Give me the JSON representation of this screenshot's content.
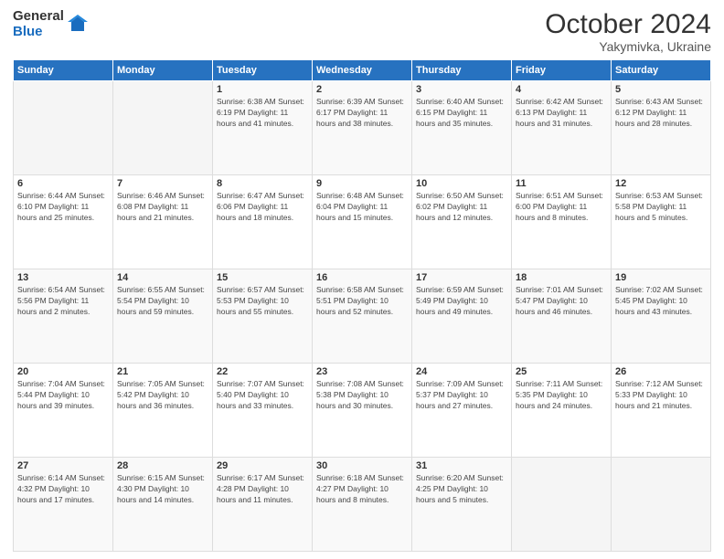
{
  "logo": {
    "general": "General",
    "blue": "Blue"
  },
  "title": {
    "month": "October 2024",
    "location": "Yakymivka, Ukraine"
  },
  "headers": [
    "Sunday",
    "Monday",
    "Tuesday",
    "Wednesday",
    "Thursday",
    "Friday",
    "Saturday"
  ],
  "weeks": [
    [
      {
        "day": "",
        "detail": ""
      },
      {
        "day": "",
        "detail": ""
      },
      {
        "day": "1",
        "detail": "Sunrise: 6:38 AM\nSunset: 6:19 PM\nDaylight: 11 hours and 41 minutes."
      },
      {
        "day": "2",
        "detail": "Sunrise: 6:39 AM\nSunset: 6:17 PM\nDaylight: 11 hours and 38 minutes."
      },
      {
        "day": "3",
        "detail": "Sunrise: 6:40 AM\nSunset: 6:15 PM\nDaylight: 11 hours and 35 minutes."
      },
      {
        "day": "4",
        "detail": "Sunrise: 6:42 AM\nSunset: 6:13 PM\nDaylight: 11 hours and 31 minutes."
      },
      {
        "day": "5",
        "detail": "Sunrise: 6:43 AM\nSunset: 6:12 PM\nDaylight: 11 hours and 28 minutes."
      }
    ],
    [
      {
        "day": "6",
        "detail": "Sunrise: 6:44 AM\nSunset: 6:10 PM\nDaylight: 11 hours and 25 minutes."
      },
      {
        "day": "7",
        "detail": "Sunrise: 6:46 AM\nSunset: 6:08 PM\nDaylight: 11 hours and 21 minutes."
      },
      {
        "day": "8",
        "detail": "Sunrise: 6:47 AM\nSunset: 6:06 PM\nDaylight: 11 hours and 18 minutes."
      },
      {
        "day": "9",
        "detail": "Sunrise: 6:48 AM\nSunset: 6:04 PM\nDaylight: 11 hours and 15 minutes."
      },
      {
        "day": "10",
        "detail": "Sunrise: 6:50 AM\nSunset: 6:02 PM\nDaylight: 11 hours and 12 minutes."
      },
      {
        "day": "11",
        "detail": "Sunrise: 6:51 AM\nSunset: 6:00 PM\nDaylight: 11 hours and 8 minutes."
      },
      {
        "day": "12",
        "detail": "Sunrise: 6:53 AM\nSunset: 5:58 PM\nDaylight: 11 hours and 5 minutes."
      }
    ],
    [
      {
        "day": "13",
        "detail": "Sunrise: 6:54 AM\nSunset: 5:56 PM\nDaylight: 11 hours and 2 minutes."
      },
      {
        "day": "14",
        "detail": "Sunrise: 6:55 AM\nSunset: 5:54 PM\nDaylight: 10 hours and 59 minutes."
      },
      {
        "day": "15",
        "detail": "Sunrise: 6:57 AM\nSunset: 5:53 PM\nDaylight: 10 hours and 55 minutes."
      },
      {
        "day": "16",
        "detail": "Sunrise: 6:58 AM\nSunset: 5:51 PM\nDaylight: 10 hours and 52 minutes."
      },
      {
        "day": "17",
        "detail": "Sunrise: 6:59 AM\nSunset: 5:49 PM\nDaylight: 10 hours and 49 minutes."
      },
      {
        "day": "18",
        "detail": "Sunrise: 7:01 AM\nSunset: 5:47 PM\nDaylight: 10 hours and 46 minutes."
      },
      {
        "day": "19",
        "detail": "Sunrise: 7:02 AM\nSunset: 5:45 PM\nDaylight: 10 hours and 43 minutes."
      }
    ],
    [
      {
        "day": "20",
        "detail": "Sunrise: 7:04 AM\nSunset: 5:44 PM\nDaylight: 10 hours and 39 minutes."
      },
      {
        "day": "21",
        "detail": "Sunrise: 7:05 AM\nSunset: 5:42 PM\nDaylight: 10 hours and 36 minutes."
      },
      {
        "day": "22",
        "detail": "Sunrise: 7:07 AM\nSunset: 5:40 PM\nDaylight: 10 hours and 33 minutes."
      },
      {
        "day": "23",
        "detail": "Sunrise: 7:08 AM\nSunset: 5:38 PM\nDaylight: 10 hours and 30 minutes."
      },
      {
        "day": "24",
        "detail": "Sunrise: 7:09 AM\nSunset: 5:37 PM\nDaylight: 10 hours and 27 minutes."
      },
      {
        "day": "25",
        "detail": "Sunrise: 7:11 AM\nSunset: 5:35 PM\nDaylight: 10 hours and 24 minutes."
      },
      {
        "day": "26",
        "detail": "Sunrise: 7:12 AM\nSunset: 5:33 PM\nDaylight: 10 hours and 21 minutes."
      }
    ],
    [
      {
        "day": "27",
        "detail": "Sunrise: 6:14 AM\nSunset: 4:32 PM\nDaylight: 10 hours and 17 minutes."
      },
      {
        "day": "28",
        "detail": "Sunrise: 6:15 AM\nSunset: 4:30 PM\nDaylight: 10 hours and 14 minutes."
      },
      {
        "day": "29",
        "detail": "Sunrise: 6:17 AM\nSunset: 4:28 PM\nDaylight: 10 hours and 11 minutes."
      },
      {
        "day": "30",
        "detail": "Sunrise: 6:18 AM\nSunset: 4:27 PM\nDaylight: 10 hours and 8 minutes."
      },
      {
        "day": "31",
        "detail": "Sunrise: 6:20 AM\nSunset: 4:25 PM\nDaylight: 10 hours and 5 minutes."
      },
      {
        "day": "",
        "detail": ""
      },
      {
        "day": "",
        "detail": ""
      }
    ]
  ]
}
